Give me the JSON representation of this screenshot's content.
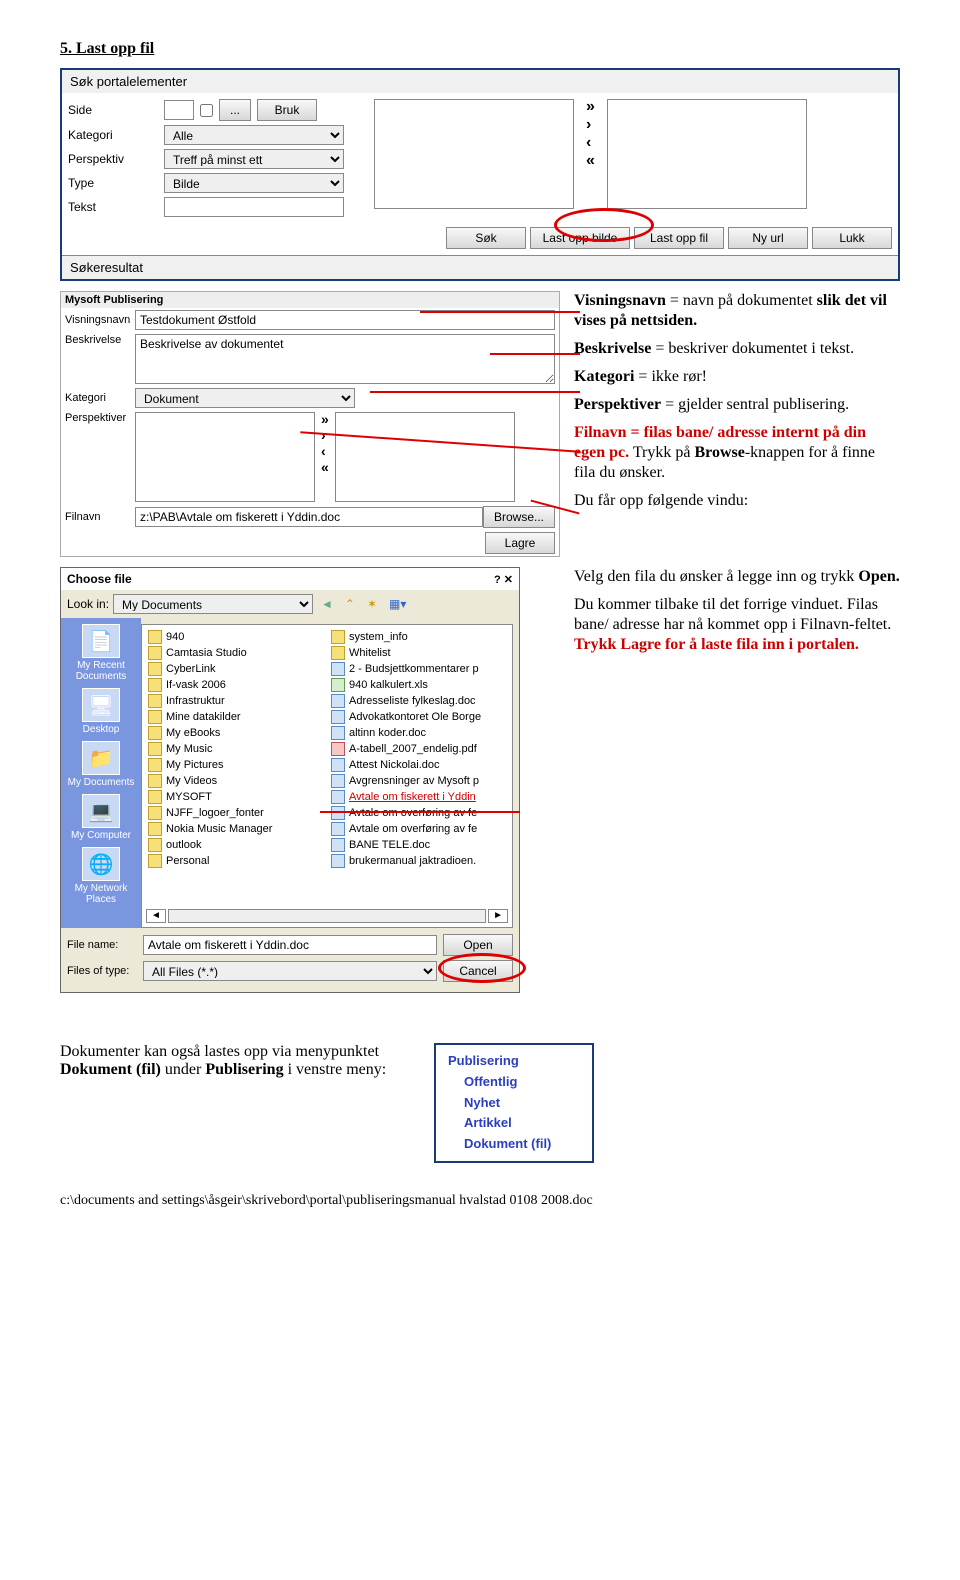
{
  "heading": "5. Last opp fil",
  "search_panel": {
    "title": "Søk portalelementer",
    "labels": {
      "side": "Side",
      "kategori": "Kategori",
      "perspektiv": "Perspektiv",
      "type": "Type",
      "tekst": "Tekst"
    },
    "values": {
      "side": "",
      "kategori": "Alle",
      "perspektiv": "Treff på minst ett",
      "type": "Bilde",
      "tekst": ""
    },
    "ellipsis": "...",
    "bruk": "Bruk",
    "buttons": {
      "sok": "Søk",
      "last_opp_bilde": "Last opp bilde",
      "last_opp_fil": "Last opp fil",
      "ny_url": "Ny url",
      "lukk": "Lukk"
    },
    "result_title": "Søkeresultat"
  },
  "publish_panel": {
    "header": "Mysoft Publisering",
    "labels": {
      "visningsnavn": "Visningsnavn",
      "beskrivelse": "Beskrivelse",
      "kategori": "Kategori",
      "perspektiver": "Perspektiver",
      "filnavn": "Filnavn"
    },
    "values": {
      "visningsnavn": "Testdokument Østfold",
      "beskrivelse": "Beskrivelse av dokumentet",
      "kategori": "Dokument",
      "filnavn": "z:\\PAB\\Avtale om fiskerett i Yddin.doc"
    },
    "browse": "Browse...",
    "lagre": "Lagre"
  },
  "side_text": {
    "p1a": "Visningsnavn",
    "p1b": " = navn på dokumentet ",
    "p1c": "slik det vil vises på nettsiden.",
    "p2a": "Beskrivelse",
    "p2b": " = beskriver dokumentet i tekst.",
    "p3a": "Kategori",
    "p3b": " = ikke rør!",
    "p4a": "Perspektiver",
    "p4b": " = gjelder sentral publisering.",
    "p5a": "Filnavn = filas bane/ adresse internt på din egen pc.",
    "p5b": " Trykk på ",
    "p5c": "Browse",
    "p5d": "-knappen for å finne fila du ønsker.",
    "p6": "Du får opp følgende vindu:",
    "p7a": "Velg den fila du ønsker å legge inn og trykk ",
    "p7b": "Open.",
    "p8a": "Du kommer tilbake til det forrige vinduet. Filas bane/ adresse har nå kommet opp i Filnavn-feltet. ",
    "p8b": "Trykk Lagre for å laste fila inn i portalen."
  },
  "dialog": {
    "title": "Choose file",
    "lookin": "Look in:",
    "lookin_val": "My Documents",
    "places": [
      "My Recent Documents",
      "Desktop",
      "My Documents",
      "My Computer",
      "My Network Places"
    ],
    "left_files": [
      {
        "n": "940",
        "t": "f"
      },
      {
        "n": "Camtasia Studio",
        "t": "f"
      },
      {
        "n": "CyberLink",
        "t": "f"
      },
      {
        "n": "If-vask 2006",
        "t": "f"
      },
      {
        "n": "Infrastruktur",
        "t": "f"
      },
      {
        "n": "Mine datakilder",
        "t": "f"
      },
      {
        "n": "My eBooks",
        "t": "f"
      },
      {
        "n": "My Music",
        "t": "f"
      },
      {
        "n": "My Pictures",
        "t": "f"
      },
      {
        "n": "My Videos",
        "t": "f"
      },
      {
        "n": "MYSOFT",
        "t": "f"
      },
      {
        "n": "NJFF_logoer_fonter",
        "t": "f"
      },
      {
        "n": "Nokia Music Manager",
        "t": "f"
      },
      {
        "n": "outlook",
        "t": "f"
      },
      {
        "n": "Personal",
        "t": "f"
      }
    ],
    "right_files": [
      {
        "n": "system_info",
        "t": "f"
      },
      {
        "n": "Whitelist",
        "t": "f"
      },
      {
        "n": "2 - Budsjettkommentarer p",
        "t": "doc"
      },
      {
        "n": "940 kalkulert.xls",
        "t": "xls"
      },
      {
        "n": "Adresseliste fylkeslag.doc",
        "t": "doc"
      },
      {
        "n": "Advokatkontoret Ole Borge",
        "t": "doc"
      },
      {
        "n": "altinn koder.doc",
        "t": "doc"
      },
      {
        "n": "A-tabell_2007_endelig.pdf",
        "t": "pdf"
      },
      {
        "n": "Attest Nickolai.doc",
        "t": "doc"
      },
      {
        "n": "Avgrensninger av Mysoft p",
        "t": "doc"
      },
      {
        "n": "Avtale om fiskerett i Yddin",
        "t": "doc"
      },
      {
        "n": "Avtale om overføring av fe",
        "t": "doc"
      },
      {
        "n": "Avtale om overføring av fe",
        "t": "doc"
      },
      {
        "n": "BANE TELE.doc",
        "t": "doc"
      },
      {
        "n": "brukermanual jaktradioen.",
        "t": "doc"
      }
    ],
    "file_name_label": "File name:",
    "file_name_val": "Avtale om fiskerett i Yddin.doc",
    "files_type_label": "Files of type:",
    "files_type_val": "All Files (*.*)",
    "open": "Open",
    "cancel": "Cancel"
  },
  "bottom_text": {
    "p1": "Dokumenter kan også lastes opp via menypunktet ",
    "p1b": "Dokument (fil)",
    "p1c": " under ",
    "p1d": "Publisering",
    "p1e": " i venstre meny:"
  },
  "menu": {
    "title": "Publisering",
    "items": [
      "Offentlig",
      "Nyhet",
      "Artikkel",
      "Dokument (fil)"
    ]
  },
  "footer": "c:\\documents and settings\\åsgeir\\skrivebord\\portal\\publiseringsmanual hvalstad 0108 2008.doc"
}
